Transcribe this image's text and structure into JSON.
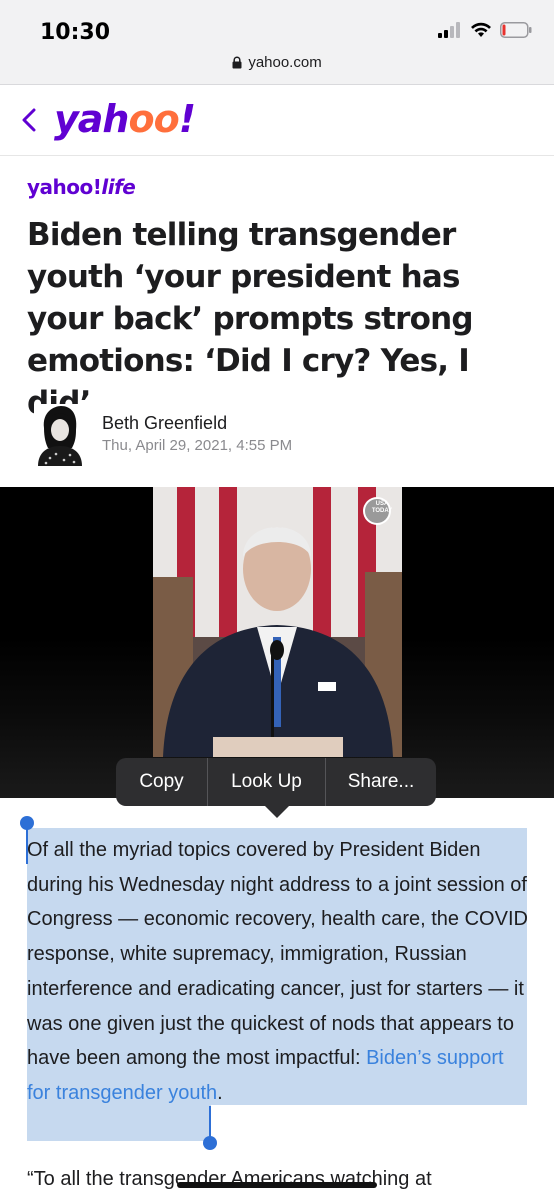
{
  "status": {
    "time": "10:30",
    "icons": [
      "cellular-signal-icon",
      "wifi-icon",
      "battery-icon"
    ]
  },
  "browser": {
    "domain": "yahoo.com",
    "lock_icon": "lock-icon"
  },
  "site": {
    "back_icon": "chevron-left-icon",
    "logo": "yahoo!",
    "section_logo_brand": "yahoo!",
    "section_logo_name": "life"
  },
  "article": {
    "headline": "Biden telling transgender youth ‘your president has your back’ prompts strong emotions: ‘Did I cry? Yes, I did’",
    "author": "Beth Greenfield",
    "date": "Thu, April 29, 2021, 4:55 PM",
    "video_badge": "USA TODAY",
    "paragraph1_text": "Of all the myriad topics covered by President Biden during his Wednesday night address to a joint session of Congress — economic recovery, health care, the COVID response, white supremacy, immigration, Russian interference and eradicating cancer, just for starters — it was one given just the quickest of nods that appears to have been among the most impactful: ",
    "paragraph1_link": "Biden’s support for transgender youth",
    "paragraph1_end": ".",
    "paragraph2_text": "“To all the transgender Americans watching at"
  },
  "context_menu": {
    "copy": "Copy",
    "look_up": "Look Up",
    "share": "Share..."
  },
  "colors": {
    "brand_purple": "#6001d2",
    "selection": "#c6d9ef",
    "link_blue": "#3a82dd",
    "handle_blue": "#2d6fd6"
  }
}
